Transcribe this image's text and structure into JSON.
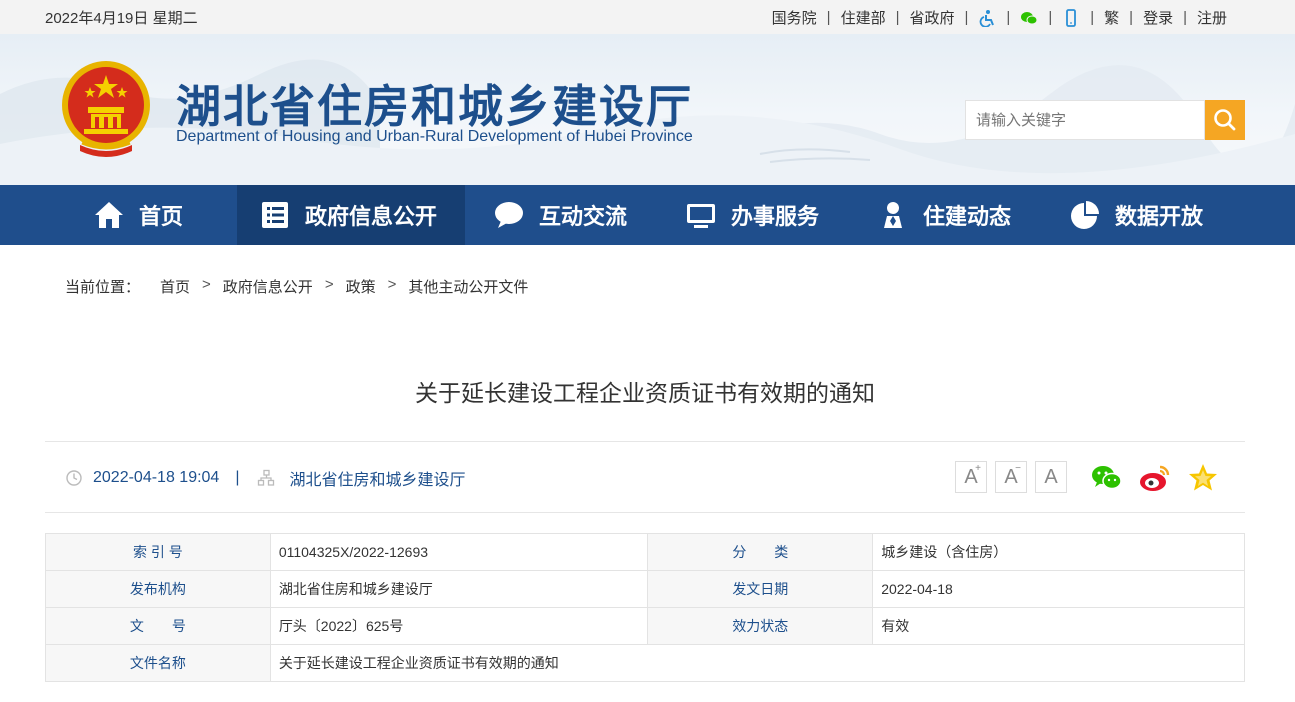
{
  "topbar": {
    "date": "2022年4月19日 星期二",
    "links": [
      "国务院",
      "住建部",
      "省政府"
    ],
    "lang": "繁",
    "login": "登录",
    "register": "注册"
  },
  "header": {
    "title": "湖北省住房和城乡建设厅",
    "subtitle": "Department of Housing and Urban-Rural Development of Hubei Province",
    "search_placeholder": "请输入关键字"
  },
  "nav": [
    {
      "label": "首页",
      "icon": "home-icon"
    },
    {
      "label": "政府信息公开",
      "icon": "document-list-icon"
    },
    {
      "label": "互动交流",
      "icon": "chat-bubble-icon"
    },
    {
      "label": "办事服务",
      "icon": "monitor-icon"
    },
    {
      "label": "住建动态",
      "icon": "person-pin-icon"
    },
    {
      "label": "数据开放",
      "icon": "pie-chart-icon"
    }
  ],
  "breadcrumb": {
    "lead": "当前位置：",
    "items": [
      "首页",
      "政府信息公开",
      "政策",
      "其他主动公开文件"
    ],
    "separator": ">"
  },
  "article": {
    "title": "关于延长建设工程企业资质证书有效期的通知",
    "datetime": "2022-04-18 19:04",
    "pipe": "|",
    "source": "湖北省住房和城乡建设厅"
  },
  "font_controls": [
    "A",
    "A",
    "A"
  ],
  "info_table": {
    "rows": [
      [
        {
          "k": "索 引 号",
          "v": "01104325X/2022-12693"
        },
        {
          "k": "分　　类",
          "v": "城乡建设（含住房）"
        }
      ],
      [
        {
          "k": "发布机构",
          "v": "湖北省住房和城乡建设厅"
        },
        {
          "k": "发文日期",
          "v": "2022-04-18"
        }
      ],
      [
        {
          "k": "文　　号",
          "v": "厅头〔2022〕625号"
        },
        {
          "k": "效力状态",
          "v": "有效"
        }
      ]
    ],
    "last_row": {
      "k": "文件名称",
      "v": "关于延长建设工程企业资质证书有效期的通知"
    }
  },
  "colors": {
    "brand_blue": "#1f4e8c",
    "nav_active": "#163e72",
    "search_button": "#f5a623"
  }
}
